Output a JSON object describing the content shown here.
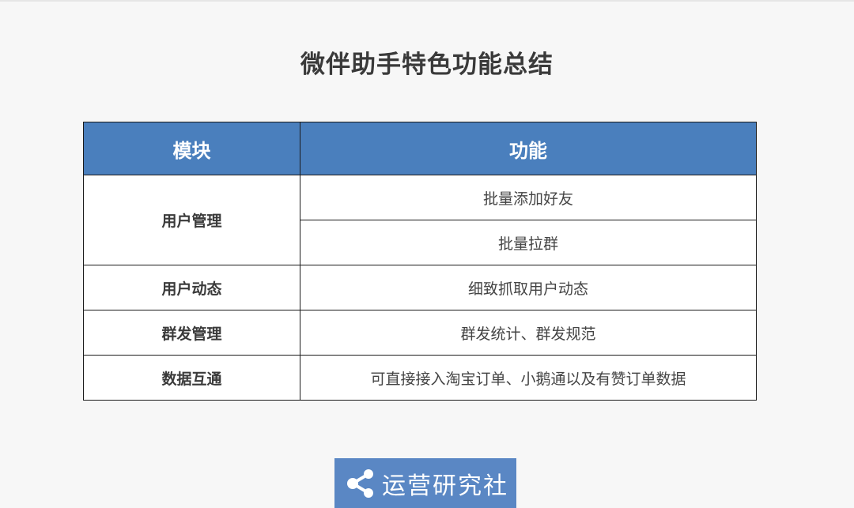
{
  "title": "微伴助手特色功能总结",
  "table": {
    "headers": [
      "模块",
      "功能"
    ],
    "rows": [
      {
        "module": "用户管理",
        "features": [
          "批量添加好友",
          "批量拉群"
        ]
      },
      {
        "module": "用户动态",
        "features": [
          "细致抓取用户动态"
        ]
      },
      {
        "module": "群发管理",
        "features": [
          "群发统计、群发规范"
        ]
      },
      {
        "module": "数据互通",
        "features": [
          "可直接接入淘宝订单、小鹅通以及有赞订单数据"
        ]
      }
    ]
  },
  "logo": {
    "text": "运营研究社",
    "icon": "share-icon"
  },
  "colors": {
    "header_bg": "#4a7fbd",
    "logo_bg": "#5a87c4",
    "title": "#3a3a3a"
  }
}
